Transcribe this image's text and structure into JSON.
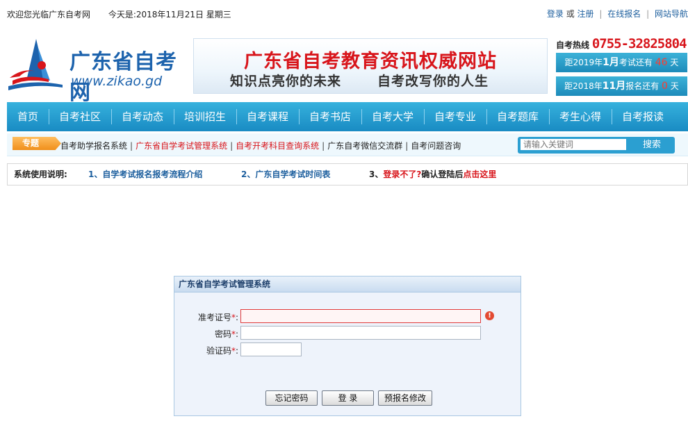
{
  "topbar": {
    "welcome": "欢迎您光临广东自考网",
    "date": "今天是:2018年11月21日 星期三",
    "links": {
      "login": "登录",
      "or": "或",
      "register": "注册",
      "online_apply": "在线报名",
      "site_nav": "网站导航"
    }
  },
  "logo": {
    "name": "广东省自考网",
    "url": "www.zikao.gd"
  },
  "banner": {
    "line1": "广东省自考教育资讯权威网站",
    "line2a": "知识点亮你的未来",
    "line2b": "自考改写你的人生"
  },
  "hotline": {
    "label": "自考热线",
    "number": "0755-32825804"
  },
  "countdown": [
    {
      "prefix": "距2019年",
      "month": "1月",
      "mid": "考试还有",
      "days": "46",
      "suffix": "天"
    },
    {
      "prefix": "距2018年",
      "month": "11月",
      "mid": "报名还有",
      "days": "0",
      "suffix": "天"
    }
  ],
  "nav": [
    "首页",
    "自考社区",
    "自考动态",
    "培训招生",
    "自考课程",
    "自考书店",
    "自考大学",
    "自考专业",
    "自考题库",
    "考生心得",
    "自考报读"
  ],
  "subnav": {
    "tag": "专题",
    "links": [
      "自考助学报名系统",
      "广东省自学考试管理系统",
      "自考开考科目查询系统",
      "广东自考微信交流群",
      "自考问题咨询"
    ],
    "search_placeholder": "请输入关键词",
    "search_button": "搜索"
  },
  "instructions": {
    "label": "系统使用说明:",
    "item1": "1、自学考试报名报考流程介绍",
    "item2": "2、广东自学考试时间表",
    "item3_prefix": "3、",
    "item3_red": "登录不了?",
    "item3_mid": "确认登陆后",
    "item3_link": "点击这里"
  },
  "login": {
    "title": "广东省自学考试管理系统",
    "fields": {
      "exam_id": {
        "label": "准考证号",
        "value": ""
      },
      "password": {
        "label": "密码",
        "value": ""
      },
      "captcha": {
        "label": "验证码",
        "value": ""
      }
    },
    "required_mark": "*",
    "colon": ":",
    "buttons": {
      "forgot": "忘记密码",
      "login": "登 录",
      "modify": "预报名修改"
    }
  },
  "colors": {
    "nav_blue": "#198bc3",
    "brand_red": "#d8151b",
    "link_blue": "#1d5f9e"
  },
  "icons": {
    "error": "exclamation-circle-icon",
    "logo": "sail-logo-icon"
  }
}
